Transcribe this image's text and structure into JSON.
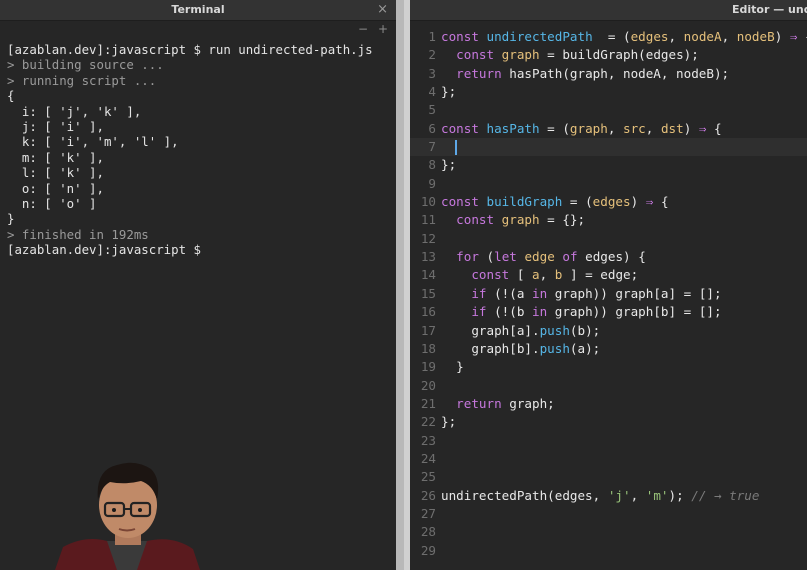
{
  "terminal": {
    "title": "Terminal",
    "close_glyph": "×",
    "controls": [
      "−",
      "+"
    ],
    "lines": [
      {
        "text": "[azablan.dev]:javascript $ run undirected-path.js",
        "dim": false
      },
      {
        "text": "> building source ...",
        "dim": true
      },
      {
        "text": "> running script ...",
        "dim": true
      },
      {
        "text": "{",
        "dim": false
      },
      {
        "text": "  i: [ 'j', 'k' ],",
        "dim": false
      },
      {
        "text": "  j: [ 'i' ],",
        "dim": false
      },
      {
        "text": "  k: [ 'i', 'm', 'l' ],",
        "dim": false
      },
      {
        "text": "  m: [ 'k' ],",
        "dim": false
      },
      {
        "text": "  l: [ 'k' ],",
        "dim": false
      },
      {
        "text": "  o: [ 'n' ],",
        "dim": false
      },
      {
        "text": "  n: [ 'o' ]",
        "dim": false
      },
      {
        "text": "}",
        "dim": false
      },
      {
        "text": "> finished in 192ms",
        "dim": true
      },
      {
        "text": "[azablan.dev]:javascript $",
        "dim": false
      }
    ]
  },
  "editor": {
    "title": "Editor — undi",
    "active_line": 7,
    "lines": [
      {
        "n": "1",
        "tokens": [
          [
            "kw",
            "const "
          ],
          [
            "fn",
            "undirectedPath"
          ],
          [
            "",
            "  = ("
          ],
          [
            "pr",
            "edges"
          ],
          [
            "",
            ", "
          ],
          [
            "pr",
            "nodeA"
          ],
          [
            "",
            ", "
          ],
          [
            "pr",
            "nodeB"
          ],
          [
            "",
            ") "
          ],
          [
            "kw",
            "⇒"
          ],
          [
            "",
            " {"
          ]
        ]
      },
      {
        "n": "2",
        "tokens": [
          [
            "",
            "  "
          ],
          [
            "kw",
            "const "
          ],
          [
            "pr",
            "graph"
          ],
          [
            "",
            " = buildGraph(edges);"
          ]
        ]
      },
      {
        "n": "3",
        "tokens": [
          [
            "",
            "  "
          ],
          [
            "kw",
            "return "
          ],
          [
            "",
            "hasPath(graph, nodeA, nodeB);"
          ]
        ]
      },
      {
        "n": "4",
        "tokens": [
          [
            "",
            "};"
          ]
        ]
      },
      {
        "n": "5",
        "tokens": []
      },
      {
        "n": "6",
        "tokens": [
          [
            "kw",
            "const "
          ],
          [
            "fn",
            "hasPath"
          ],
          [
            "",
            " = ("
          ],
          [
            "pr",
            "graph"
          ],
          [
            "",
            ", "
          ],
          [
            "pr",
            "src"
          ],
          [
            "",
            ", "
          ],
          [
            "pr",
            "dst"
          ],
          [
            "",
            ") "
          ],
          [
            "kw",
            "⇒"
          ],
          [
            "",
            " {"
          ]
        ]
      },
      {
        "n": "7",
        "tokens": []
      },
      {
        "n": "8",
        "tokens": [
          [
            "",
            "};"
          ]
        ]
      },
      {
        "n": "9",
        "tokens": []
      },
      {
        "n": "10",
        "tokens": [
          [
            "kw",
            "const "
          ],
          [
            "fn",
            "buildGraph"
          ],
          [
            "",
            " = ("
          ],
          [
            "pr",
            "edges"
          ],
          [
            "",
            ") "
          ],
          [
            "kw",
            "⇒"
          ],
          [
            "",
            " {"
          ]
        ]
      },
      {
        "n": "11",
        "tokens": [
          [
            "",
            "  "
          ],
          [
            "kw",
            "const "
          ],
          [
            "pr",
            "graph"
          ],
          [
            "",
            " = {};"
          ]
        ]
      },
      {
        "n": "12",
        "tokens": []
      },
      {
        "n": "13",
        "tokens": [
          [
            "",
            "  "
          ],
          [
            "kw",
            "for "
          ],
          [
            "",
            "("
          ],
          [
            "kw",
            "let "
          ],
          [
            "pr",
            "edge "
          ],
          [
            "kw",
            "of "
          ],
          [
            "",
            "edges) {"
          ]
        ]
      },
      {
        "n": "14",
        "tokens": [
          [
            "",
            "    "
          ],
          [
            "kw",
            "const "
          ],
          [
            "",
            "[ "
          ],
          [
            "pr",
            "a"
          ],
          [
            "",
            ", "
          ],
          [
            "pr",
            "b"
          ],
          [
            "",
            " ] = edge;"
          ]
        ]
      },
      {
        "n": "15",
        "tokens": [
          [
            "",
            "    "
          ],
          [
            "kw",
            "if "
          ],
          [
            "",
            "(!(a "
          ],
          [
            "kw",
            "in "
          ],
          [
            "",
            "graph)) graph[a] = [];"
          ]
        ]
      },
      {
        "n": "16",
        "tokens": [
          [
            "",
            "    "
          ],
          [
            "kw",
            "if "
          ],
          [
            "",
            "(!(b "
          ],
          [
            "kw",
            "in "
          ],
          [
            "",
            "graph)) graph[b] = [];"
          ]
        ]
      },
      {
        "n": "17",
        "tokens": [
          [
            "",
            "    graph[a]."
          ],
          [
            "fn",
            "push"
          ],
          [
            "",
            "(b);"
          ]
        ]
      },
      {
        "n": "18",
        "tokens": [
          [
            "",
            "    graph[b]."
          ],
          [
            "fn",
            "push"
          ],
          [
            "",
            "(a);"
          ]
        ]
      },
      {
        "n": "19",
        "tokens": [
          [
            "",
            "  }"
          ]
        ]
      },
      {
        "n": "20",
        "tokens": []
      },
      {
        "n": "21",
        "tokens": [
          [
            "",
            "  "
          ],
          [
            "kw",
            "return "
          ],
          [
            "",
            "graph;"
          ]
        ]
      },
      {
        "n": "22",
        "tokens": [
          [
            "",
            "};"
          ]
        ]
      },
      {
        "n": "23",
        "tokens": []
      },
      {
        "n": "24",
        "tokens": []
      },
      {
        "n": "25",
        "tokens": []
      },
      {
        "n": "26",
        "tokens": [
          [
            "",
            "undirectedPath(edges, "
          ],
          [
            "st",
            "'j'"
          ],
          [
            "",
            ", "
          ],
          [
            "st",
            "'m'"
          ],
          [
            "",
            "); "
          ],
          [
            "cm",
            "// → true"
          ]
        ]
      },
      {
        "n": "27",
        "tokens": []
      },
      {
        "n": "28",
        "tokens": []
      },
      {
        "n": "29",
        "tokens": []
      }
    ]
  },
  "colors": {
    "background": "#262626",
    "keyword": "#c678dd",
    "function": "#56b6e6",
    "param": "#e5c07b",
    "string": "#98c379",
    "comment": "#7a7a7a",
    "caret": "#5ea8e8"
  }
}
